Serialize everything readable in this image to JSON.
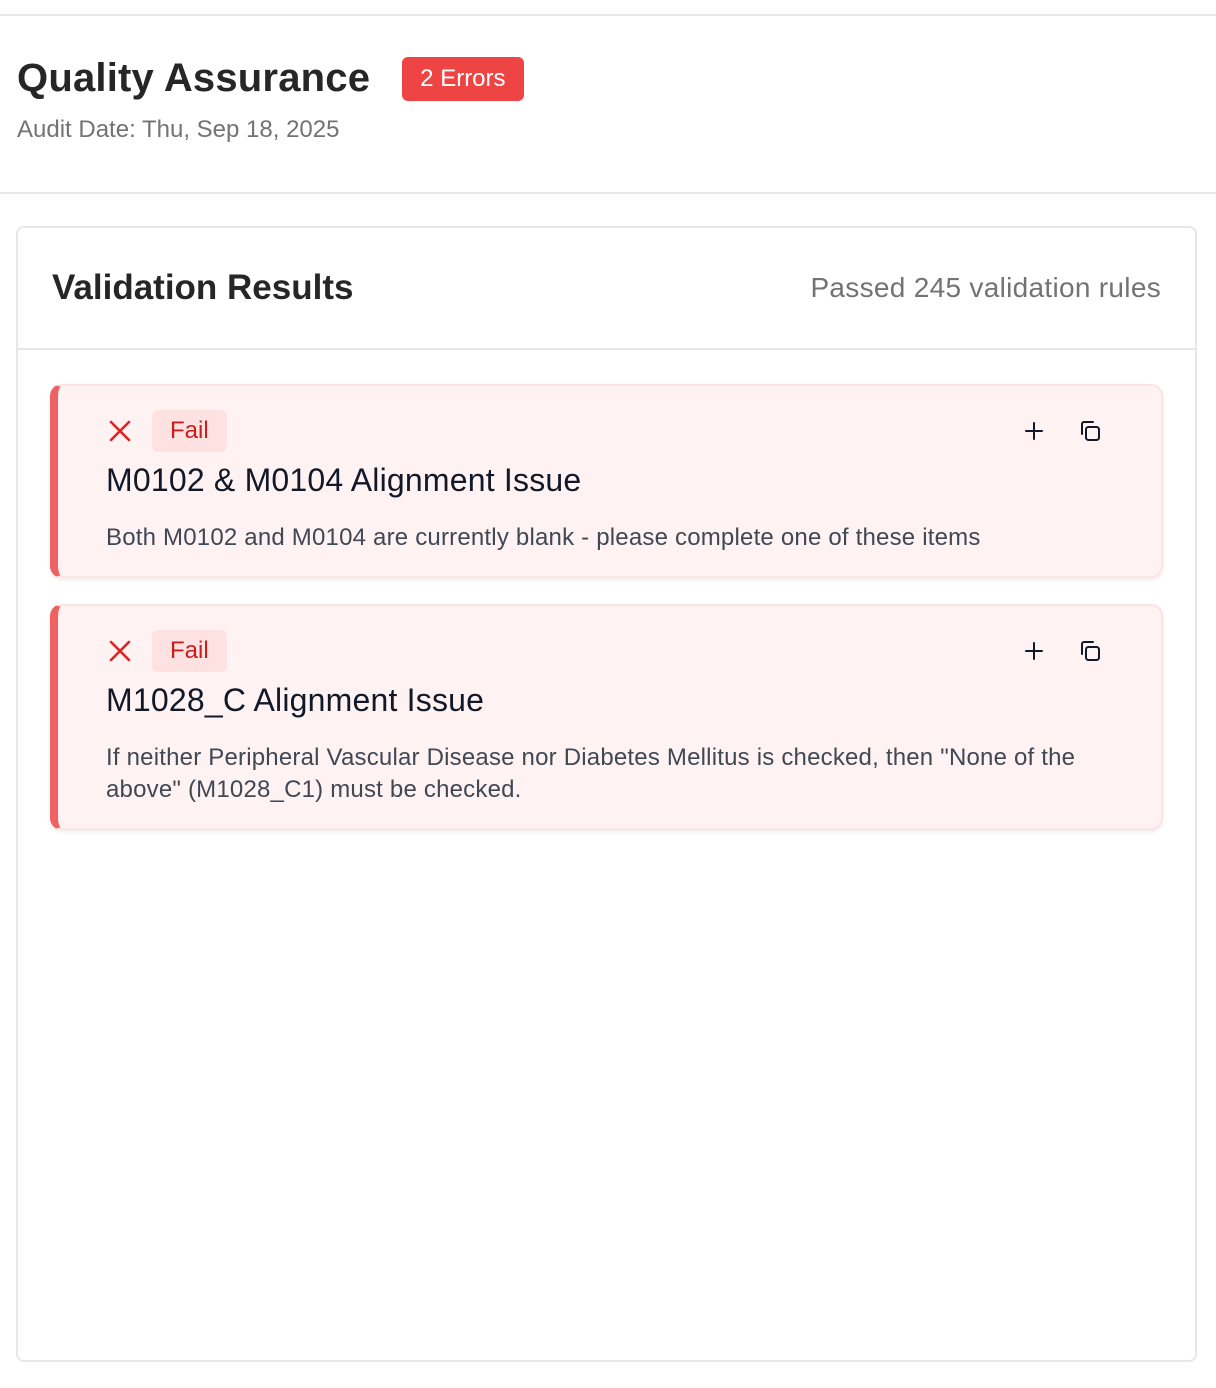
{
  "header": {
    "title": "Quality Assurance",
    "error_badge": "2 Errors",
    "audit_date": "Audit Date: Thu, Sep 18, 2025"
  },
  "results": {
    "title": "Validation Results",
    "summary": "Passed 245 validation rules"
  },
  "issues": [
    {
      "status": "Fail",
      "title": "M0102 & M0104 Alignment Issue",
      "description": "Both M0102 and M0104 are currently blank - please complete one of these items"
    },
    {
      "status": "Fail",
      "title": "M1028_C Alignment Issue",
      "description": "If neither Peripheral Vascular Disease nor Diabetes Mellitus is checked, then \"None of the above\" (M1028_C1) must be checked."
    }
  ],
  "colors": {
    "error": "#ef4444",
    "fail_text": "#c81e1e",
    "fail_bg": "#fee2e2",
    "issue_bg": "#fef2f2",
    "accent_border": "#f06262"
  },
  "icons": {
    "status": "close-icon",
    "add": "plus-icon",
    "copy": "copy-icon"
  }
}
